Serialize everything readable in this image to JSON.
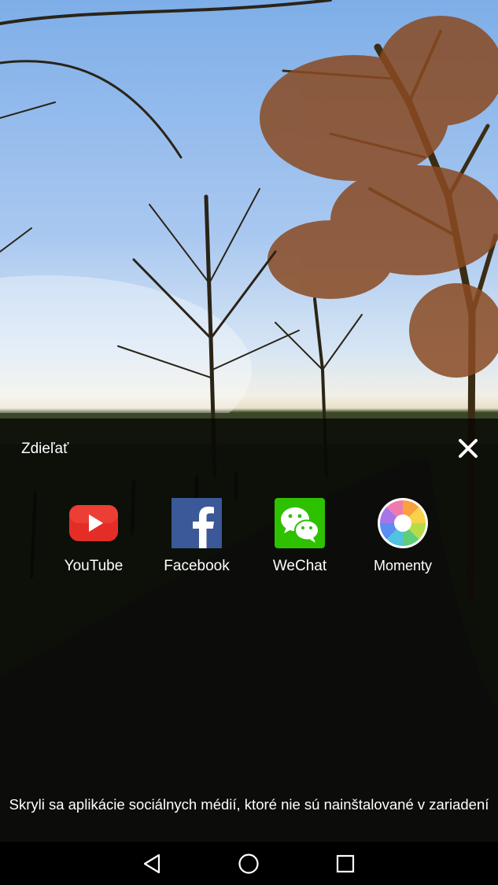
{
  "share": {
    "title": "Zdieľať",
    "close_icon": "close-icon",
    "apps": [
      {
        "label": "YouTube",
        "icon": "youtube-icon",
        "color": "#e52d27"
      },
      {
        "label": "Facebook",
        "icon": "facebook-icon",
        "color": "#3b5998"
      },
      {
        "label": "WeChat",
        "icon": "wechat-icon",
        "color": "#2dc100"
      },
      {
        "label": "Momenty",
        "icon": "momenty-icon",
        "color": "#ffffff"
      }
    ],
    "notice": "Skryli sa aplikácie sociálnych médií, ktoré nie sú nainštalované v zariadení"
  },
  "navbar": {
    "back_icon": "back-triangle-icon",
    "home_icon": "home-circle-icon",
    "recents_icon": "recents-square-icon"
  }
}
